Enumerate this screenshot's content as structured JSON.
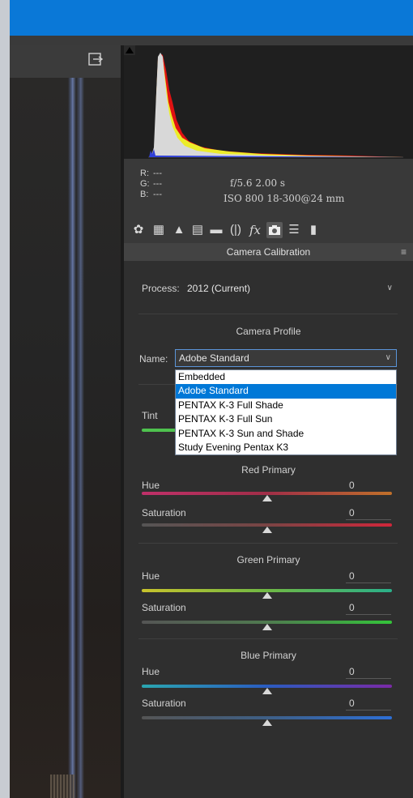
{
  "histogram": {
    "info": {
      "r_label": "R:",
      "r_value": "---",
      "g_label": "G:",
      "g_value": "---",
      "b_label": "B:",
      "b_value": "---",
      "aperture_shutter": "f/5.6   2.00 s",
      "iso_lens": "ISO 800   18-300@24 mm"
    }
  },
  "tool_icons": [
    "basic-icon",
    "tone-curve-icon",
    "detail-icon",
    "hsl-icon",
    "split-toning-icon",
    "lens-corrections-icon",
    "effects-icon",
    "camera-calibration-icon",
    "presets-icon",
    "snapshots-icon"
  ],
  "panel": {
    "title": "Camera Calibration",
    "process_label": "Process:",
    "process_value": "2012 (Current)",
    "camera_profile_title": "Camera Profile",
    "name_label": "Name:",
    "name_value": "Adobe Standard",
    "dropdown_options": [
      "Embedded",
      "Adobe Standard",
      "PENTAX K-3 Full Shade",
      "PENTAX K-3 Full Sun",
      "PENTAX K-3 Sun and Shade",
      "Study Evening Pentax K3"
    ],
    "dropdown_selected_index": 1,
    "shadows_tint_label": "Tint",
    "red_primary_title": "Red Primary",
    "green_primary_title": "Green Primary",
    "blue_primary_title": "Blue Primary",
    "hue_label": "Hue",
    "saturation_label": "Saturation",
    "red_hue": "0",
    "red_saturation": "0",
    "green_hue": "0",
    "green_saturation": "0",
    "blue_hue": "0",
    "blue_saturation": "0"
  },
  "colors": {
    "titlebar": "#0a78d7",
    "selection": "#0078d7"
  }
}
